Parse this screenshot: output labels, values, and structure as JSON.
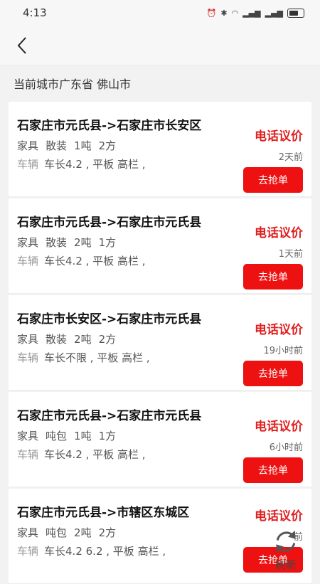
{
  "status_bar": {
    "time": "4:13"
  },
  "city": {
    "label": "当前城市广东省 佛山市"
  },
  "cards": [
    {
      "route": "石家庄市元氏县->石家庄市长安区",
      "category": "家具",
      "packing": "散装",
      "weight": "1吨",
      "volume": "2方",
      "vehicle_label": "车辆",
      "vehicle": "车长4.2 , 平板 高栏 ,",
      "price": "电话议价",
      "time": "2天前",
      "button": "去抢单"
    },
    {
      "route": "石家庄市元氏县->石家庄市元氏县",
      "category": "家具",
      "packing": "散装",
      "weight": "2吨",
      "volume": "1方",
      "vehicle_label": "车辆",
      "vehicle": "车长4.2 , 平板 高栏 ,",
      "price": "电话议价",
      "time": "1天前",
      "button": "去抢单"
    },
    {
      "route": "石家庄市长安区->石家庄市元氏县",
      "category": "家具",
      "packing": "散装",
      "weight": "2吨",
      "volume": "2方",
      "vehicle_label": "车辆",
      "vehicle": "车长不限 , 平板 高栏 ,",
      "price": "电话议价",
      "time": "19小时前",
      "button": "去抢单"
    },
    {
      "route": "石家庄市元氏县->石家庄市元氏县",
      "category": "家具",
      "packing": "吨包",
      "weight": "1吨",
      "volume": "1方",
      "vehicle_label": "车辆",
      "vehicle": "车长4.2 , 平板 高栏 ,",
      "price": "电话议价",
      "time": "6小时前",
      "button": "去抢单"
    },
    {
      "route": "石家庄市元氏县->市辖区东城区",
      "category": "家具",
      "packing": "吨包",
      "weight": "2吨",
      "volume": "2方",
      "vehicle_label": "车辆",
      "vehicle": "车长4.2 6.2 , 平板 高栏 ,",
      "price": "电话议价",
      "time": "前",
      "button": "去抢单"
    }
  ],
  "refresh": {
    "label": "刷新"
  },
  "colors": {
    "accent": "#ee1111",
    "price": "#e02020"
  }
}
